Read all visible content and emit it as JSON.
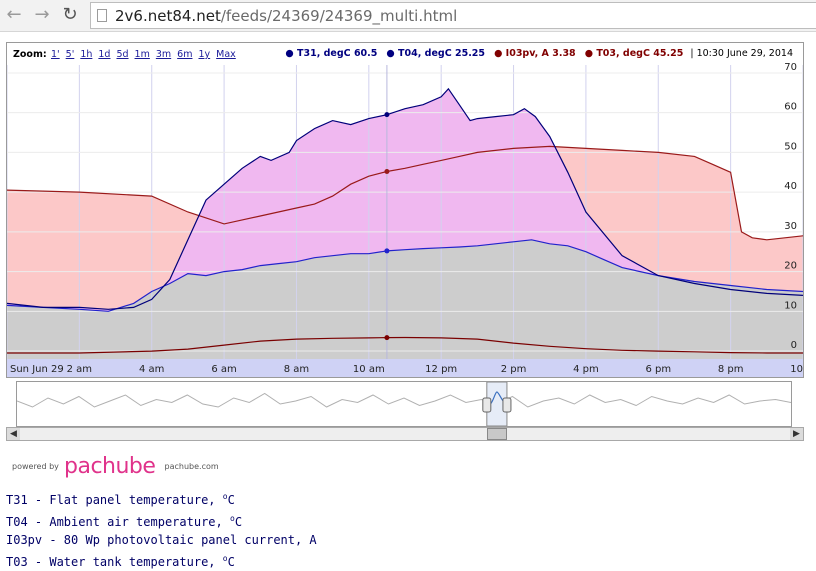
{
  "browser": {
    "url_host": "2v6.net84.net",
    "url_path": "/feeds/24369/24369_multi.html"
  },
  "toolbar": {
    "zoom_label": "Zoom:",
    "zoom_links": [
      "1'",
      "5'",
      "1h",
      "1d",
      "5d",
      "1m",
      "3m",
      "6m",
      "1y",
      "Max"
    ],
    "legend": [
      {
        "label": "T31, degC 60.5",
        "color": "#000080"
      },
      {
        "label": "T04, degC 25.25",
        "color": "#000080"
      },
      {
        "label": "I03pv, A 3.38",
        "color": "#800000"
      },
      {
        "label": "T03, degC 45.25",
        "color": "#800000"
      }
    ],
    "timestamp": "10:30 June 29, 2014"
  },
  "colors": {
    "t31": "#00007a",
    "t04": "#2222cc",
    "t03": "#9a1a1a",
    "i03": "#7a0000",
    "fill_pink": "#fcc8c8",
    "fill_gray": "#cdcdcd",
    "fill_magenta": "#f0b8f0",
    "axis_band": "#cfd2f5"
  },
  "chart_data": {
    "type": "line",
    "x_unit": "hours since Jun 29 00:00",
    "xlim": [
      0,
      22
    ],
    "ylim": [
      -2,
      72
    ],
    "y_ticks": [
      0,
      10,
      20,
      30,
      40,
      50,
      60,
      70
    ],
    "x_ticks": [
      {
        "x": 0,
        "label": "Sun Jun 29"
      },
      {
        "x": 2,
        "label": "2 am"
      },
      {
        "x": 4,
        "label": "4 am"
      },
      {
        "x": 6,
        "label": "6 am"
      },
      {
        "x": 8,
        "label": "8 am"
      },
      {
        "x": 10,
        "label": "10 am"
      },
      {
        "x": 12,
        "label": "12 pm"
      },
      {
        "x": 14,
        "label": "2 pm"
      },
      {
        "x": 16,
        "label": "4 pm"
      },
      {
        "x": 18,
        "label": "6 pm"
      },
      {
        "x": 20,
        "label": "8 pm"
      },
      {
        "x": 22,
        "label": "10"
      }
    ],
    "grid": true,
    "marker_x": 10.5,
    "series": [
      {
        "name": "T31",
        "key": "t31",
        "x": [
          0,
          1,
          2,
          2.8,
          3.5,
          4,
          4.5,
          5,
          5.5,
          6,
          6.5,
          7,
          7.3,
          7.8,
          8,
          8.5,
          9,
          9.5,
          10,
          10.5,
          11,
          11.5,
          12,
          12.2,
          12.5,
          12.8,
          13,
          13.5,
          14,
          14.3,
          14.6,
          15,
          15.5,
          16,
          17,
          18,
          19,
          20,
          21,
          22
        ],
        "y": [
          12,
          11,
          11,
          10.5,
          11,
          13,
          18,
          28,
          38,
          42,
          46,
          49,
          48,
          50,
          53,
          56,
          58,
          57,
          58.5,
          59.5,
          61,
          62,
          64,
          66,
          62,
          58,
          58.5,
          59,
          59.5,
          61,
          59,
          54,
          45,
          35,
          24,
          19,
          17,
          15.5,
          14.5,
          14
        ]
      },
      {
        "name": "T04",
        "key": "t04",
        "x": [
          0,
          1,
          2,
          2.8,
          3.5,
          4,
          4.5,
          5,
          5.5,
          6,
          6.5,
          7,
          7.5,
          8,
          8.5,
          9,
          9.5,
          10,
          10.5,
          11,
          11.5,
          12,
          12.5,
          13,
          13.5,
          14,
          14.5,
          15,
          15.5,
          16,
          16.5,
          17,
          18,
          19,
          20,
          21,
          22
        ],
        "y": [
          11.5,
          11,
          10.5,
          10,
          12,
          15,
          17,
          19.5,
          19,
          20,
          20.5,
          21.5,
          22,
          22.5,
          23.5,
          24,
          24.5,
          24.5,
          25.2,
          25.5,
          25.8,
          26,
          26.2,
          26.5,
          27,
          27.5,
          28,
          27,
          26.5,
          25,
          23,
          21,
          19,
          17.5,
          16.5,
          15.5,
          15
        ]
      },
      {
        "name": "T03",
        "key": "t03",
        "x": [
          0,
          2,
          4,
          5,
          6,
          6.5,
          7,
          7.5,
          8,
          8.5,
          9,
          9.5,
          10,
          10.5,
          11,
          11.5,
          12,
          12.5,
          13,
          14,
          15,
          16,
          17,
          18,
          19,
          19.5,
          20,
          20.3,
          20.6,
          21,
          22
        ],
        "y": [
          40.5,
          40,
          39,
          35,
          32,
          33,
          34,
          35,
          36,
          37,
          39,
          42,
          44,
          45.2,
          46,
          47,
          48,
          49,
          50,
          51,
          51.5,
          51,
          50.5,
          50,
          49,
          47,
          45,
          30,
          28.5,
          28,
          29
        ]
      },
      {
        "name": "I03pv",
        "key": "i03",
        "x": [
          0,
          2,
          4,
          5,
          6,
          7,
          8,
          9,
          10,
          10.5,
          11,
          12,
          13,
          14,
          15,
          16,
          17,
          18,
          19,
          20,
          21,
          22
        ],
        "y": [
          -0.5,
          -0.5,
          0,
          0.5,
          1.5,
          2.5,
          3,
          3.2,
          3.3,
          3.38,
          3.4,
          3.3,
          3,
          2,
          1.2,
          0.6,
          0.2,
          0,
          -0.2,
          -0.4,
          -0.5,
          -0.5
        ]
      }
    ]
  },
  "overview": {
    "x": [
      0,
      0.02,
      0.04,
      0.06,
      0.08,
      0.1,
      0.12,
      0.14,
      0.16,
      0.18,
      0.2,
      0.22,
      0.24,
      0.26,
      0.28,
      0.3,
      0.32,
      0.34,
      0.36,
      0.38,
      0.4,
      0.42,
      0.44,
      0.46,
      0.48,
      0.5,
      0.52,
      0.54,
      0.56,
      0.58,
      0.6,
      0.62,
      0.64,
      0.66,
      0.68,
      0.7,
      0.72,
      0.74,
      0.76,
      0.78,
      0.8,
      0.82,
      0.84,
      0.86,
      0.88,
      0.9,
      0.92,
      0.94,
      0.96,
      0.98,
      1
    ],
    "y": [
      0.5,
      0.7,
      0.4,
      0.6,
      0.35,
      0.7,
      0.5,
      0.3,
      0.65,
      0.45,
      0.55,
      0.3,
      0.6,
      0.7,
      0.4,
      0.55,
      0.25,
      0.6,
      0.5,
      0.35,
      0.7,
      0.45,
      0.55,
      0.3,
      0.6,
      0.4,
      0.65,
      0.5,
      0.3,
      0.55,
      0.45,
      0.6,
      0.35,
      0.7,
      0.5,
      0.4,
      0.6,
      0.3,
      0.55,
      0.45,
      0.65,
      0.35,
      0.5,
      0.6,
      0.4,
      0.55,
      0.3,
      0.6,
      0.5,
      0.45,
      0.55
    ],
    "window_start": 0.607,
    "window_end": 0.633
  },
  "footer": {
    "powered_by": "powered by",
    "logo": "pachube",
    "domain": "pachube.com",
    "descriptions": [
      {
        "code": "T31",
        "text": " - Flat panel temperature, ",
        "unit": "C",
        "deg": "o"
      },
      {
        "code": "T04",
        "text": " - Ambient air temperature, ",
        "unit": "C",
        "deg": "o"
      },
      {
        "code": "I03pv",
        "text": " - 80 Wp photovoltaic panel current, A",
        "unit": "",
        "deg": ""
      },
      {
        "code": "T03",
        "text": " - Water tank temperature, ",
        "unit": "C",
        "deg": "o"
      }
    ]
  }
}
